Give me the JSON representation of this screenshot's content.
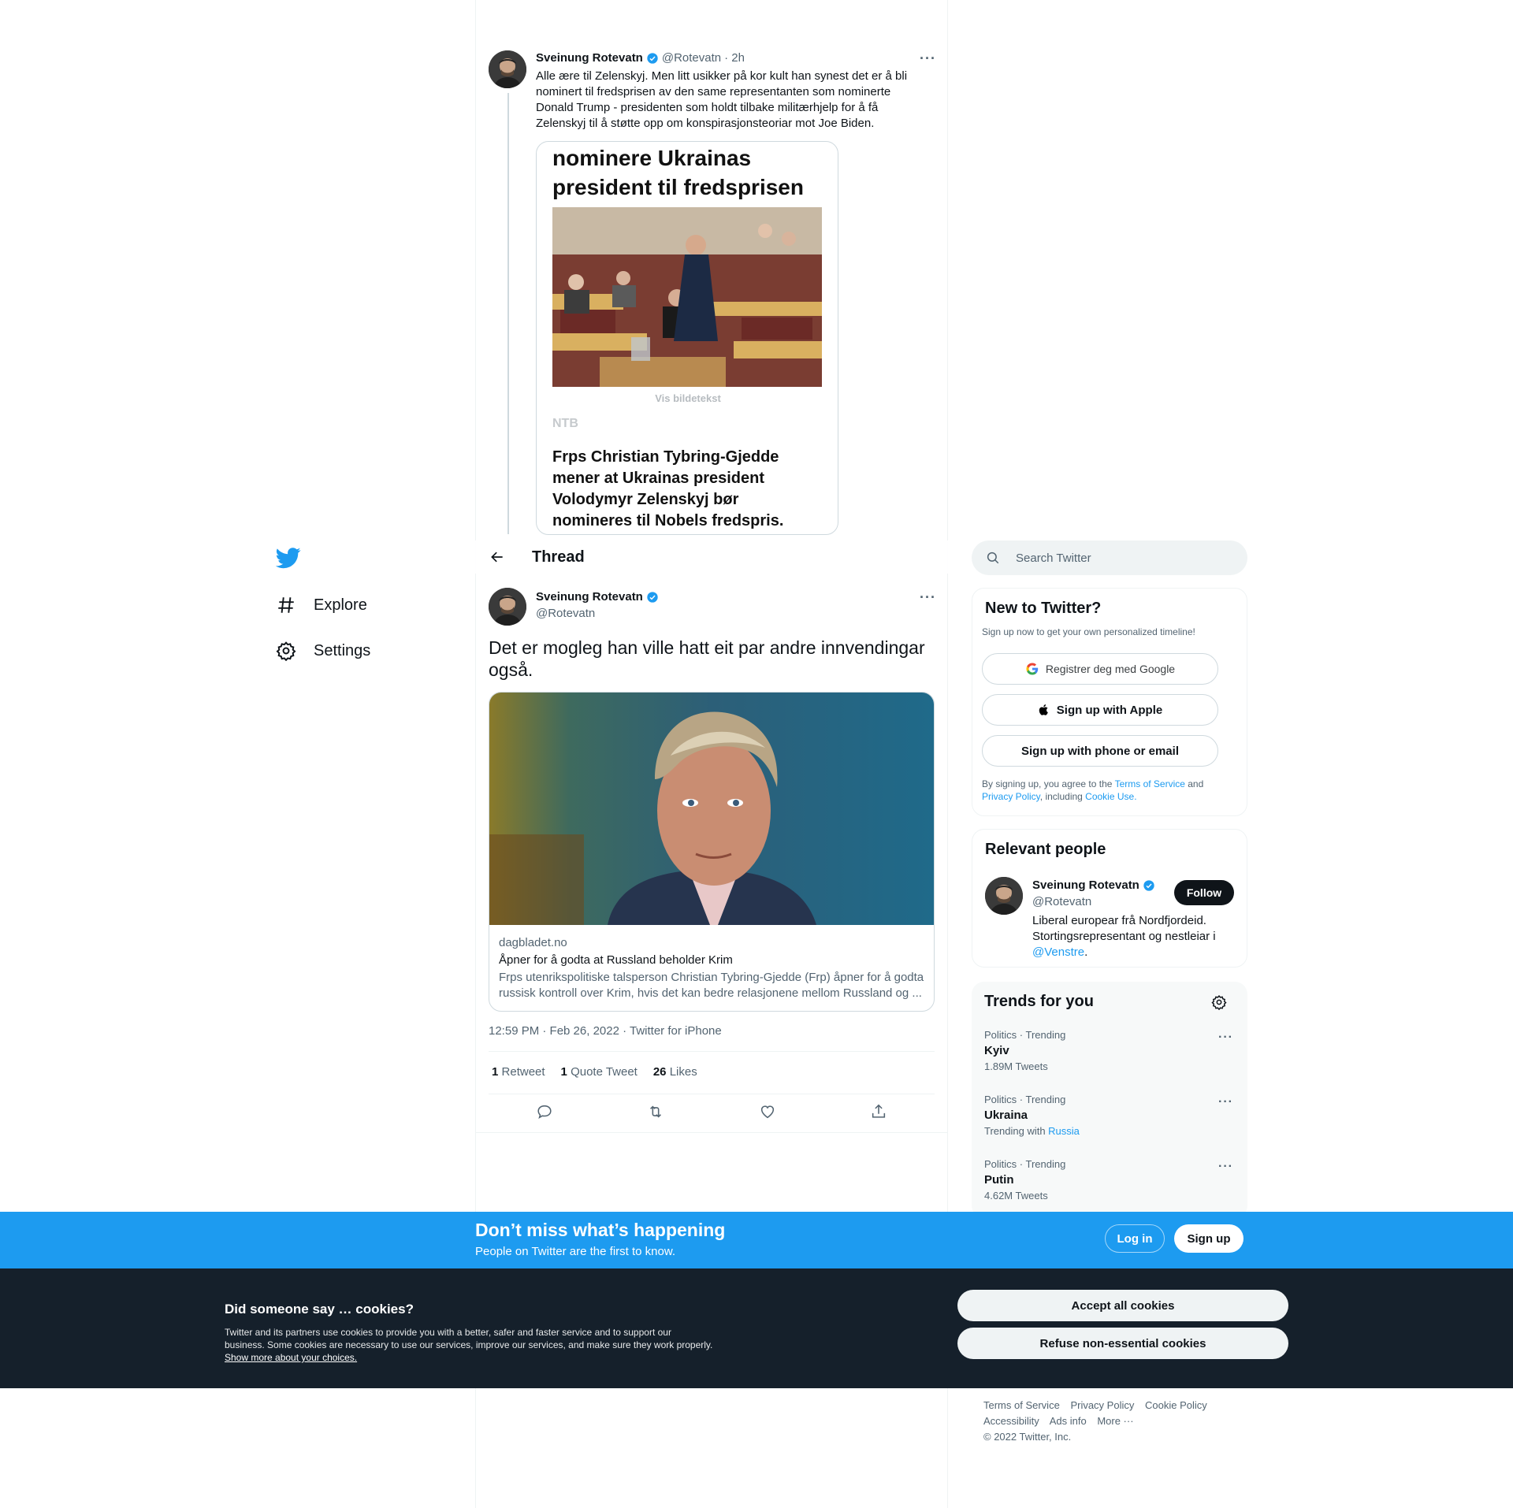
{
  "nav": {
    "explore": "Explore",
    "settings": "Settings"
  },
  "previous_tweet": {
    "name": "Sveinung Rotevatn",
    "handle": "@Rotevatn",
    "time": "· 2h",
    "text": "Alle ære til Zelenskyj. Men litt usikker på kor kult han synest det er å bli nominert til fredsprisen av den same representanten som nominerte Donald Trump - presidenten som holdt tilbake militærhjelp for å få Zelenskyj til å støtte opp om konspirasjonsteoriar mot Joe Biden.",
    "image": {
      "headline": "nominere Ukrainas president til fredsprisen",
      "caption": "Vis bildetekst",
      "source": "NTB",
      "lead": "Frps Christian Tybring-Gjedde mener at Ukrainas president Volodymyr Zelenskyj bør nomineres til Nobels fredspris."
    }
  },
  "header": {
    "title": "Thread"
  },
  "main_tweet": {
    "name": "Sveinung Rotevatn",
    "handle": "@Rotevatn",
    "text": "Det er mogleg han ville hatt eit par andre innvendingar også.",
    "link_card": {
      "domain": "dagbladet.no",
      "title": "Åpner for å godta at Russland beholder Krim",
      "description": "Frps utenrikspolitiske talsperson Christian Tybring-Gjedde (Frp) åpner for å godta russisk kontroll over Krim, hvis det kan bedre relasjonene mellom Russland og ..."
    },
    "meta": "12:59 PM · Feb 26, 2022 · Twitter for iPhone",
    "stats": {
      "retweets_count": "1",
      "retweets_label": "Retweet",
      "quotes_count": "1",
      "quotes_label": "Quote Tweet",
      "likes_count": "26",
      "likes_label": "Likes"
    }
  },
  "search": {
    "placeholder": "Search Twitter"
  },
  "new_to_twitter": {
    "title": "New to Twitter?",
    "subtitle": "Sign up now to get your own personalized timeline!",
    "google_btn": "Registrer deg med Google",
    "apple_btn": "Sign up with Apple",
    "phone_btn": "Sign up with phone or email",
    "terms_prefix": "By signing up, you agree to the ",
    "terms_link": "Terms of Service",
    "terms_and": " and",
    "privacy_link": "Privacy Policy",
    "including": ", including ",
    "cookie_link": "Cookie Use."
  },
  "relevant_people": {
    "title": "Relevant people",
    "name": "Sveinung Rotevatn",
    "handle": "@Rotevatn",
    "follow": "Follow",
    "bio": "Liberal europear frå Nordfjordeid. Stortingsrepresentant og nestleiar i ",
    "bio_link": "@Venstre",
    "bio_end": "."
  },
  "trends": {
    "title": "Trends for you",
    "items": [
      {
        "category": "Politics · Trending",
        "term": "Kyiv",
        "count": "1.89M Tweets"
      },
      {
        "category": "Politics · Trending",
        "term": "Ukraina",
        "count_prefix": "Trending with ",
        "count_link": "Russia"
      },
      {
        "category": "Politics · Trending",
        "term": "Putin",
        "count": "4.62M Tweets"
      }
    ]
  },
  "banner": {
    "title": "Don’t miss what’s happening",
    "subtitle": "People on Twitter are the first to know.",
    "login": "Log in",
    "signup": "Sign up"
  },
  "cookies": {
    "title": "Did someone say … cookies?",
    "text": "Twitter and its partners use cookies to provide you with a better, safer and faster service and to support our business. Some cookies are necessary to use our services, improve our services, and make sure they work properly. ",
    "link": "Show more about your choices.",
    "accept": "Accept all cookies",
    "refuse": "Refuse non-essential cookies"
  },
  "footer": {
    "terms": "Terms of Service",
    "privacy": "Privacy Policy",
    "cookie": "Cookie Policy",
    "accessibility": "Accessibility",
    "ads": "Ads info",
    "more": "More ···",
    "copyright": "© 2022 Twitter, Inc."
  },
  "colors": {
    "accent": "#1d9bf0",
    "text": "#0f1419",
    "secondary": "#536471",
    "cookie_bg": "#15202b"
  }
}
